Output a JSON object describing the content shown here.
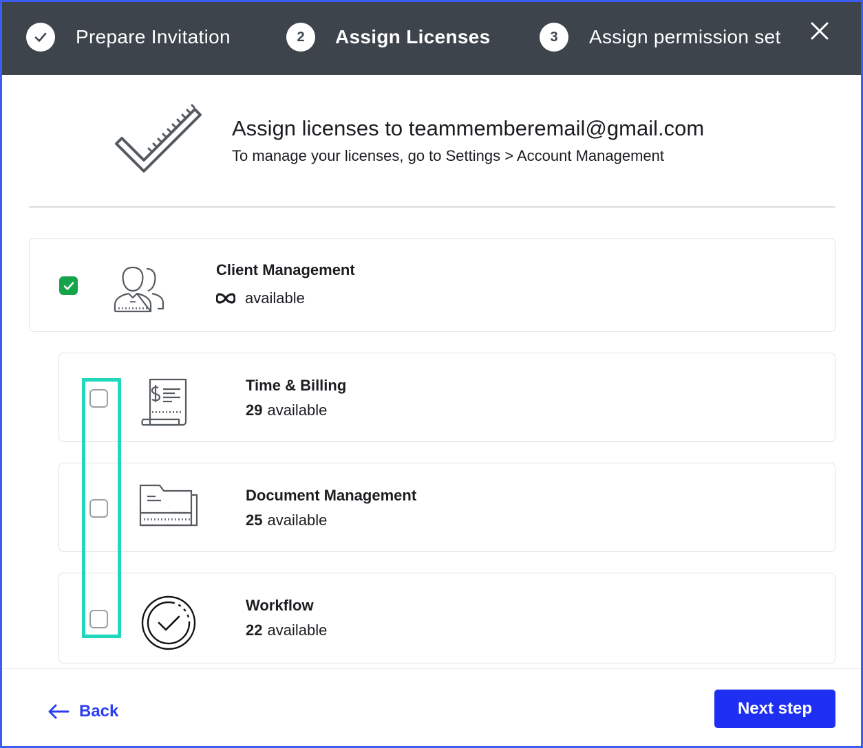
{
  "stepper": {
    "steps": [
      {
        "number": "",
        "label": "Prepare Invitation",
        "state": "completed"
      },
      {
        "number": "2",
        "label": "Assign Licenses",
        "state": "current"
      },
      {
        "number": "3",
        "label": "Assign permission set",
        "state": "upcoming"
      }
    ],
    "close_icon": "close-icon"
  },
  "intro": {
    "illustration": "checkmark-ruler-illustration",
    "title": "Assign licenses to teammemberemail@gmail.com",
    "subtitle": "To manage your licenses, go to Settings > Account Management"
  },
  "licenses": {
    "main": {
      "name": "Client Management",
      "availability_symbol": "∞",
      "available_label": "available",
      "checked": true,
      "icon": "users-icon"
    },
    "items": [
      {
        "name": "Time & Billing",
        "count": "29",
        "available_label": "available",
        "checked": false,
        "icon": "invoice-icon"
      },
      {
        "name": "Document Management",
        "count": "25",
        "available_label": "available",
        "checked": false,
        "icon": "folder-icon"
      },
      {
        "name": "Workflow",
        "count": "22",
        "available_label": "available",
        "checked": false,
        "icon": "check-circle-icon"
      }
    ]
  },
  "footer": {
    "back_label": "Back",
    "next_label": "Next step"
  },
  "colors": {
    "header_bg": "#3d444c",
    "primary": "#1f2ff2",
    "success": "#16a34a",
    "highlight": "#22d8bc",
    "frame_border": "#3d5cf0"
  }
}
